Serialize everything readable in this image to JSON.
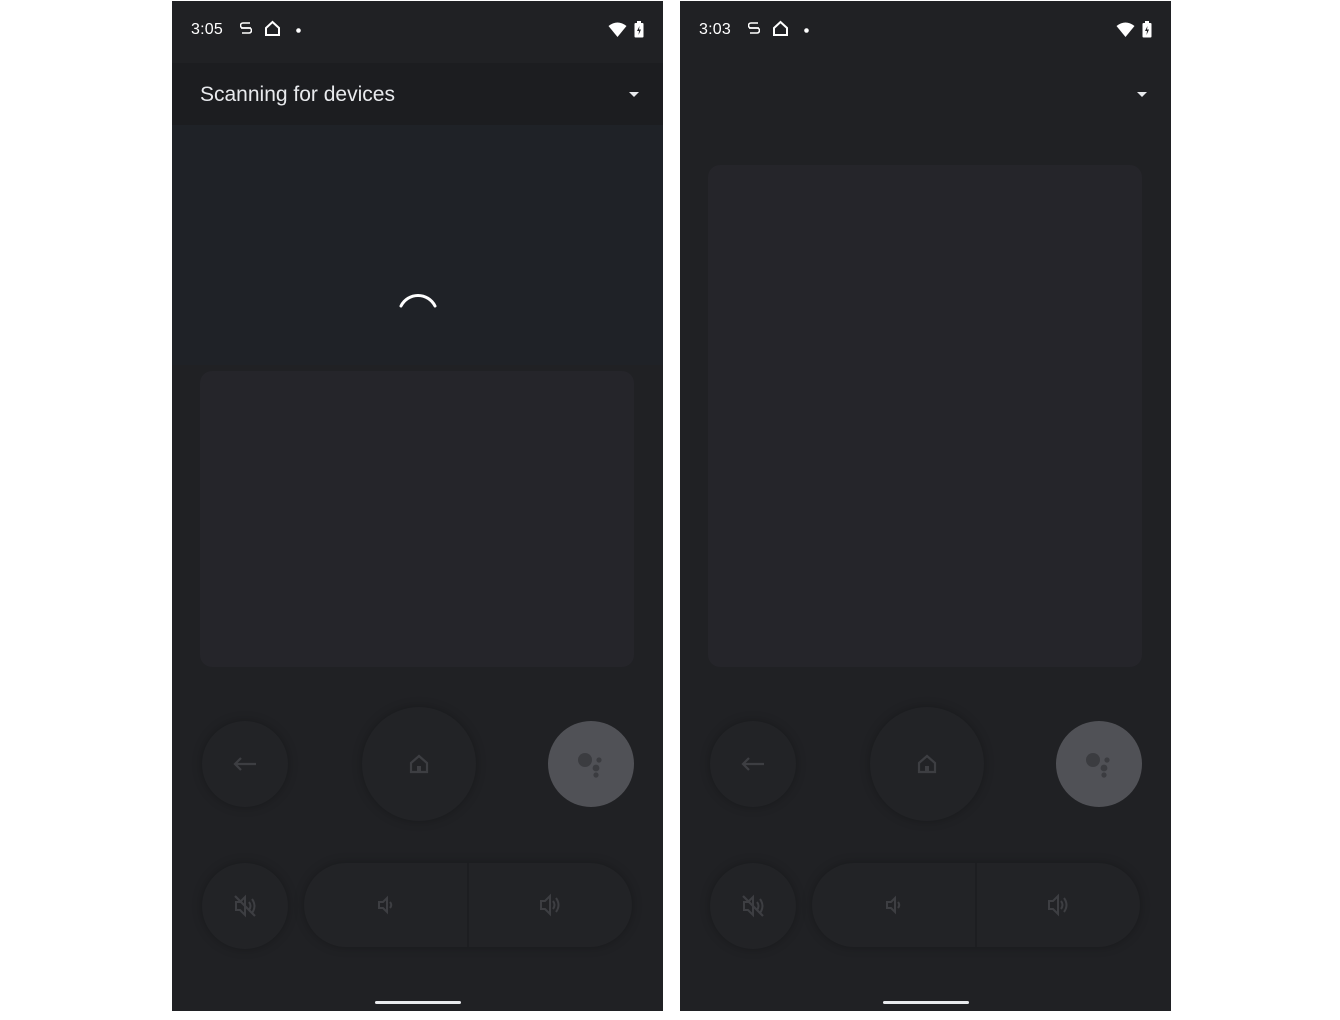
{
  "screens": [
    {
      "status_bar": {
        "time": "3:05"
      },
      "header": {
        "device_title": "Scanning for devices"
      },
      "scanning": true
    },
    {
      "status_bar": {
        "time": "3:03"
      },
      "header": {
        "device_title": ""
      },
      "scanning": false
    }
  ],
  "icons": {
    "status": [
      "sync-icon",
      "home-outline-icon",
      "notification-dot-icon",
      "wifi-icon",
      "battery-icon"
    ],
    "header": [
      "dropdown-arrow-icon"
    ],
    "controls": [
      "back-arrow-icon",
      "home-icon",
      "google-assistant-icon",
      "mute-icon",
      "volume-down-icon",
      "volume-up-icon"
    ]
  },
  "colors": {
    "background": "#202124",
    "header": "#1c1d20",
    "touchpad": "#25252a",
    "assistant_button": "#505156",
    "text": "#e8eaed"
  }
}
